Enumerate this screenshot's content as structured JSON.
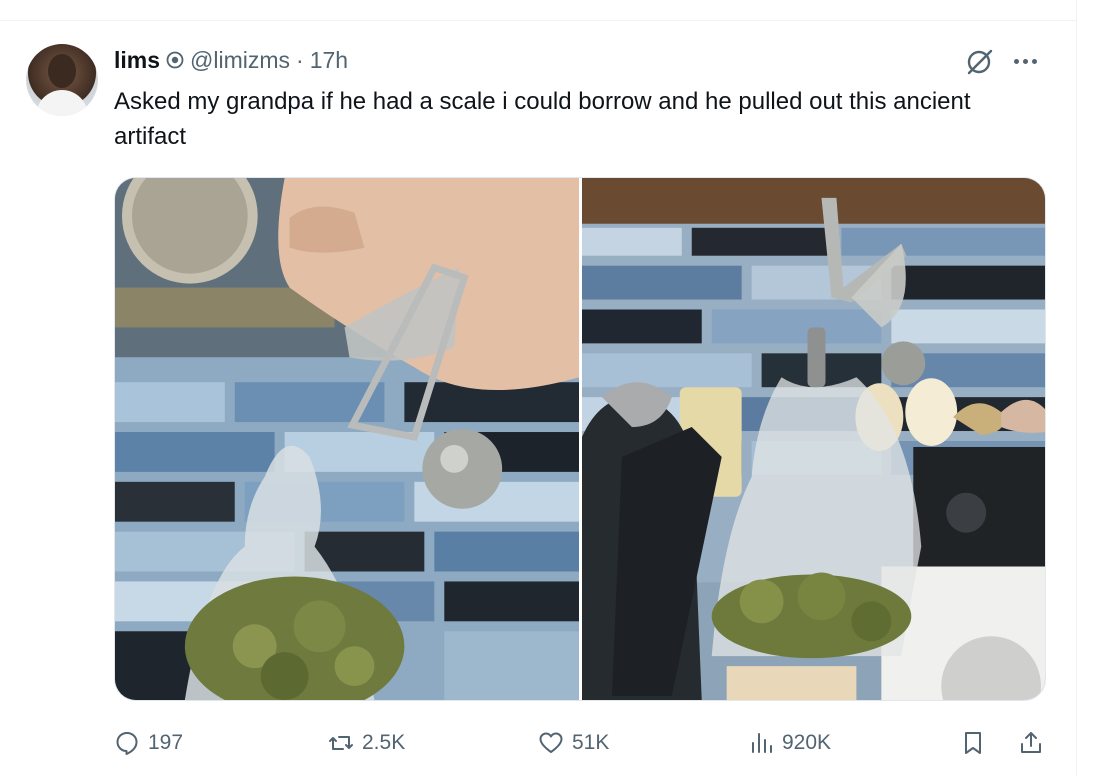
{
  "author": {
    "name": "lims",
    "handle": "@limizms",
    "separator": "·",
    "time": "17h"
  },
  "tweet": {
    "text": "Asked my grandpa if he had a scale i could borrow and he pulled out this ancient artifact"
  },
  "media": {
    "photos": [
      {
        "subject": "hand holding vintage letter scale with bag of buds"
      },
      {
        "subject": "vintage letter scale hanging over stove with bag of buds"
      }
    ]
  },
  "actions": {
    "replies": "197",
    "reposts": "2.5K",
    "likes": "51K",
    "views": "920K"
  },
  "icons": {
    "verified": "verified-icon",
    "grok": "grok-icon",
    "more": "more-icon",
    "reply": "reply-icon",
    "repost": "repost-icon",
    "like": "heart-icon",
    "views": "views-icon",
    "bookmark": "bookmark-icon",
    "share": "share-icon"
  },
  "colors": {
    "text": "#0f1419",
    "secondary": "#536471",
    "divider": "#eff3f4"
  }
}
